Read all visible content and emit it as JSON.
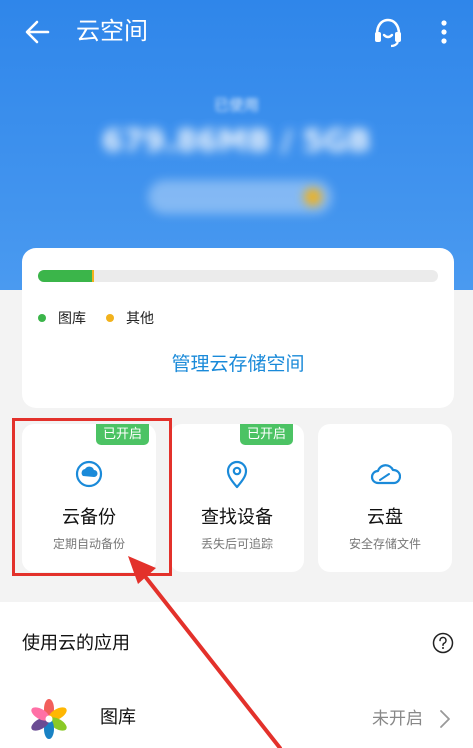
{
  "header": {
    "title": "云空间",
    "back_icon": "arrow-left-icon",
    "support_icon": "headset-icon",
    "more_icon": "more-vertical-icon"
  },
  "storage": {
    "used_label": "已使用",
    "used_value": "679.86MB / 5GB",
    "gallery_fraction": 0.135,
    "other_fraction": 0.005,
    "legend": [
      {
        "label": "图库",
        "color": "#3bb54a"
      },
      {
        "label": "其他",
        "color": "#f2b21c"
      }
    ],
    "manage_label": "管理云存储空间"
  },
  "features": [
    {
      "badge": "已开启",
      "title": "云备份",
      "subtitle": "定期自动备份",
      "icon": "cloud-sync-icon"
    },
    {
      "badge": "已开启",
      "title": "查找设备",
      "subtitle": "丢失后可追踪",
      "icon": "location-pin-icon"
    },
    {
      "badge": "",
      "title": "云盘",
      "subtitle": "安全存储文件",
      "icon": "cloud-drive-icon"
    }
  ],
  "apps": {
    "header": "使用云的应用",
    "help_icon": "help-circle-icon",
    "items": [
      {
        "name": "图库",
        "status": "未开启",
        "icon": "gallery-flower-icon"
      }
    ]
  },
  "colors": {
    "accent": "#2f86ea",
    "link": "#1a8ad9",
    "badge": "#4cc364",
    "annotation": "#e3312b"
  }
}
